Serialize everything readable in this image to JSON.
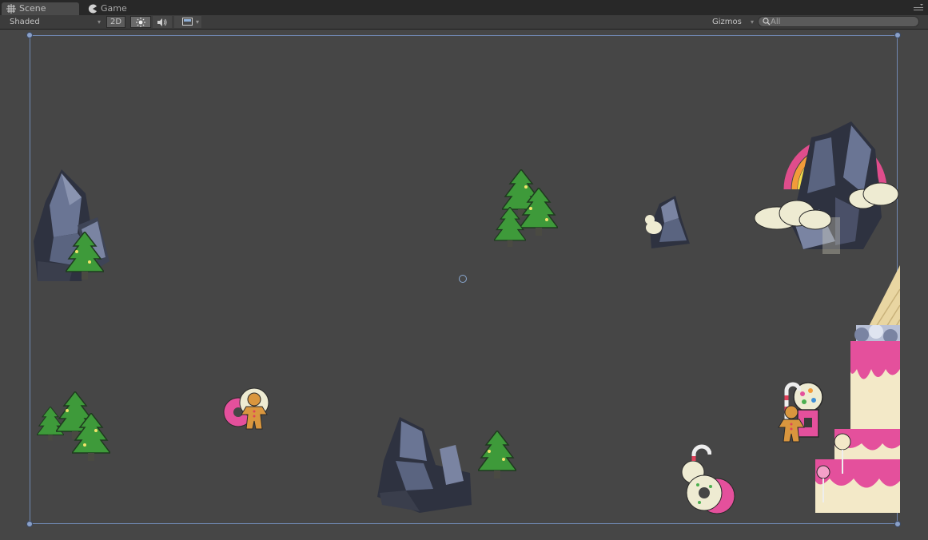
{
  "tabs": [
    {
      "label": "Scene",
      "icon": "scene-grid-icon",
      "active": true
    },
    {
      "label": "Game",
      "icon": "game-pacman-icon",
      "active": false
    }
  ],
  "toolbar": {
    "shading": "Shaded",
    "mode_2d": "2D",
    "lighting_icon": "sun-icon",
    "audio_icon": "speaker-icon",
    "effects_icon": "image-effects-icon",
    "gizmos": "Gizmos",
    "search_placeholder": "All"
  },
  "colors": {
    "background": "#464646",
    "tabbar": "#282828",
    "toolbar": "#3c3c3c",
    "frame": "#7088b2",
    "tree": "#3e9a3a",
    "rock": "#5f6a86",
    "pink": "#e4509c"
  },
  "scene": {
    "objects": [
      "rock",
      "tree",
      "rainbow",
      "cloud",
      "gingerbread",
      "donut",
      "cake",
      "candy-cane",
      "gumball-machine",
      "lollipop",
      "ice-cream-cone"
    ]
  }
}
